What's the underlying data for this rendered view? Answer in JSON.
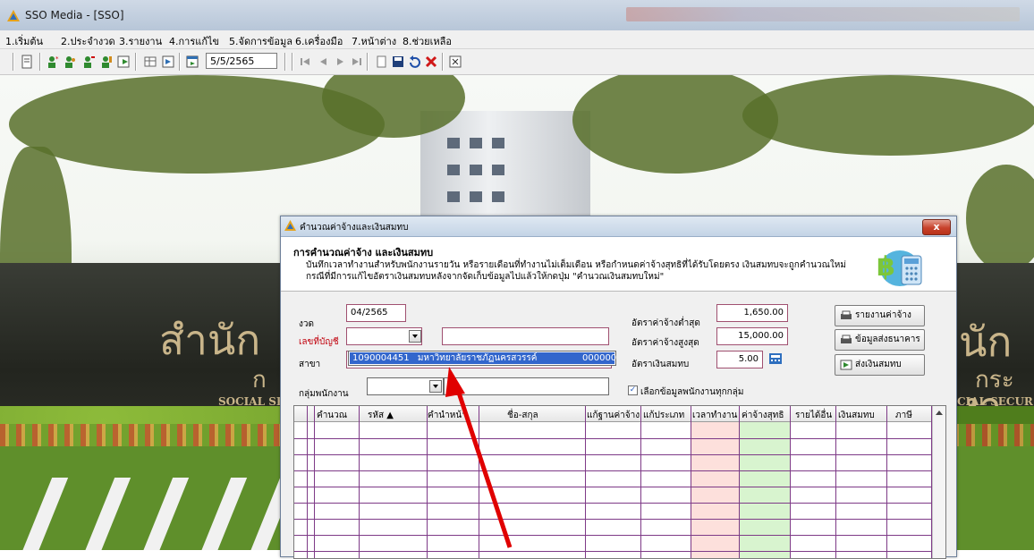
{
  "app": {
    "title": "SSO Media - [SSO]"
  },
  "menu": [
    "1.เริ่มต้น",
    "2.ประจำงวด",
    "3.รายงาน",
    "4.การแก้ไข",
    "5.จัดการข้อมูล",
    "6.เครื่องมือ",
    "7.หน้าต่าง",
    "8.ช่วยเหลือ"
  ],
  "toolbar": {
    "date_value": "5/5/2565"
  },
  "background": {
    "sign_left": "สำนัก",
    "sign_left_small": "ก",
    "sign_right": "นักงา",
    "sign_right_small": "กระ",
    "social_left": "SOCIAL SE",
    "social_right": "CIAL SECUR"
  },
  "dialog": {
    "title": "คำนวณค่าจ้างและเงินสมทบ",
    "heading": "การคำนวณค่าจ้าง และเงินสมทบ",
    "desc_line1": "บันทึกเวลาทำงานสำหรับพนักงานรายวัน หรือรายเดือนที่ทำงานไม่เต็มเดือน หรือกำหนดค่าจ้างสุทธิที่ได้รับโดยตรง เงินสมทบจะถูกคำนวณใหม่",
    "desc_line2": "กรณีที่มีการแก้ไขอัตราเงินสมทบหลังจากจัดเก็บข้อมูลไปแล้วให้กดปุ่ม \"คำนวณเงินสมทบใหม่\"",
    "close": "x",
    "fields": {
      "period_label": "งวด",
      "period_value": "04/2565",
      "account_label": "เลขที่บัญชี",
      "account_value": "",
      "branch_label": "สาขา",
      "group_label": "กลุ่มพนักงาน",
      "group_value": "",
      "min_wage_label": "อัตราค่าจ้างต่ำสุด",
      "min_wage_value": "1,650.00",
      "max_wage_label": "อัตราค่าจ้างสูงสุด",
      "max_wage_value": "15,000.00",
      "rate_label": "อัตราเงินสมทบ",
      "rate_value": "5.00",
      "all_groups_label": "เลือกข้อมูลพนักงานทุกกลุ่ม",
      "all_groups_checked": true
    },
    "dropdown_option": {
      "code": "1090004451",
      "name": "มหาวิทยาลัยราชภัฏนครสวรรค์",
      "branch": "000000"
    },
    "buttons": {
      "wage_report": "รายงานค่าจ้าง",
      "bank_data": "ข้อมูลส่งธนาคาร",
      "send_contrib": "ส่งเงินสมทบ"
    },
    "grid": {
      "columns": [
        "คำนวณ",
        "รหัส ▲",
        "คำนำหน้า",
        "ชื่อ-สกุล",
        "แก้ฐานค่าจ้าง",
        "แก้ประเภท",
        "เวลาทำงาน",
        "ค่าจ้างสุทธิ",
        "รายได้อื่น",
        "เงินสมทบ",
        "ภาษี"
      ]
    }
  },
  "colors": {
    "annotation_arrow": "#e00000",
    "selection": "#3266cc"
  }
}
